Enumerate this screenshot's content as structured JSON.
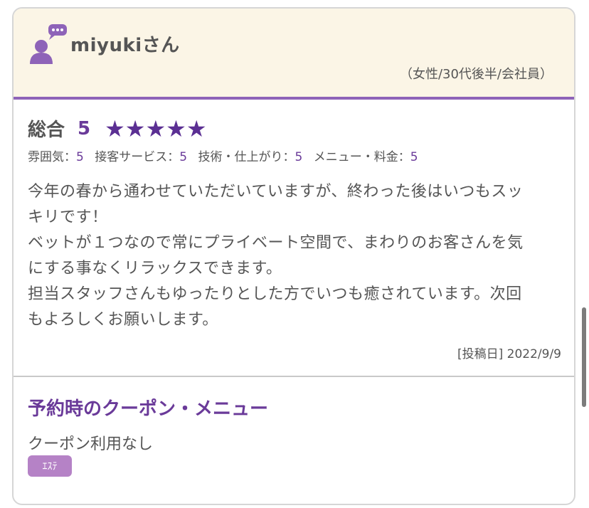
{
  "header": {
    "username": "miyukiさん",
    "meta": "（女性/30代後半/会社員）"
  },
  "ratings": {
    "overall_label": "総合",
    "overall_score": "5",
    "stars": "★★★★★",
    "star_count": 5,
    "sub": [
      {
        "label": "雰囲気：",
        "value": "5"
      },
      {
        "label": "接客サービス：",
        "value": "5"
      },
      {
        "label": "技術・仕上がり：",
        "value": "5"
      },
      {
        "label": "メニュー・料金：",
        "value": "5"
      }
    ]
  },
  "review": {
    "lines": [
      "今年の春から通わせていただいていますが、終わった後はいつもスッ",
      "キリです！",
      "ベットが１つなので常にプライベート空間で、まわりのお客さんを気",
      "にする事なくリラックスできます。",
      "担当スタッフさんもゆったりとした方でいつも癒されています。次回",
      "もよろしくお願いします。"
    ],
    "posted": "[投稿日] 2022/9/9"
  },
  "coupon": {
    "title": "予約時のクーポン・メニュー",
    "text": "クーポン利用なし",
    "tag": "ｴｽﾃ"
  },
  "colors": {
    "accent": "#6a3a99",
    "header_bg": "#fbf5e6",
    "tag_bg": "#b582c6"
  }
}
